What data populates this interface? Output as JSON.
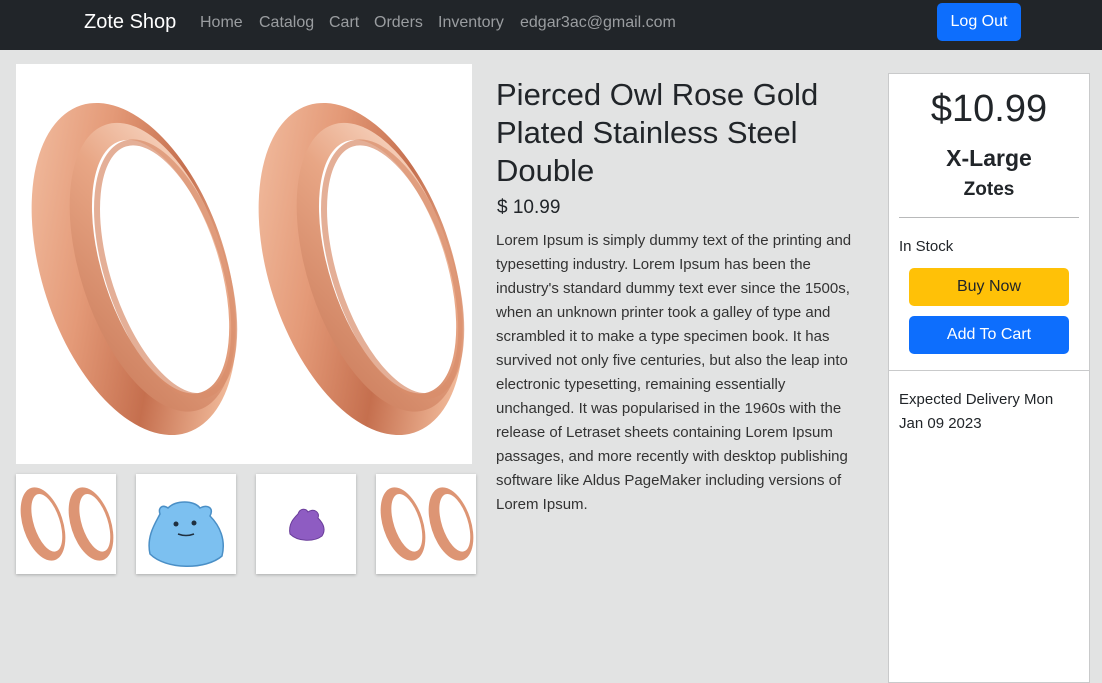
{
  "navbar": {
    "brand": "Zote Shop",
    "links": [
      "Home",
      "Catalog",
      "Cart",
      "Orders",
      "Inventory"
    ],
    "user_email": "edgar3ac@gmail.com",
    "logout_label": "Log Out"
  },
  "product": {
    "title": "Pierced Owl Rose Gold Plated Stainless Steel Double",
    "price": "$ 10.99",
    "description": "Lorem Ipsum is simply dummy text of the printing and typesetting industry. Lorem Ipsum has been the industry's standard dummy text ever since the 1500s, when an unknown printer took a galley of type and scrambled it to make a type specimen book. It has survived not only five centuries, but also the leap into electronic typesetting, remaining essentially unchanged. It was popularised in the 1960s with the release of Letraset sheets containing Lorem Ipsum passages, and more recently with desktop publishing software like Aldus PageMaker including versions of Lorem Ipsum."
  },
  "buy_card": {
    "price": "$10.99",
    "size": "X-Large",
    "unit": "Zotes",
    "stock": "In Stock",
    "buy_label": "Buy Now",
    "cart_label": "Add To Cart",
    "delivery": "Expected Delivery Mon Jan 09 2023"
  },
  "thumbnails": [
    "rose-gold-tunnels",
    "blue-ditto-plush",
    "purple-ditto",
    "rose-gold-tunnels"
  ],
  "colors": {
    "navbar": "#212529",
    "primary": "#0d6efd",
    "warning": "#ffc107",
    "background": "#e2e3e3"
  }
}
